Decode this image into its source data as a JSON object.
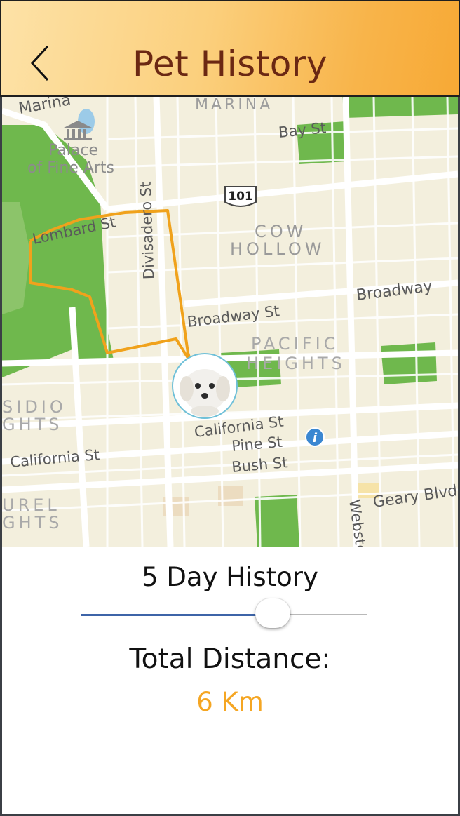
{
  "header": {
    "title": "Pet History",
    "back_icon": "chevron-left-icon"
  },
  "map": {
    "labels": {
      "marina_top": "Marina",
      "marina": "MARINA",
      "palace_1": "Palace",
      "palace_2": "of Fine Arts",
      "divisadero": "Divisadero St",
      "bay": "Bay St",
      "hwy": "101",
      "lombard": "Lombard St",
      "cow_1": "COW",
      "cow_2": "HOLLOW",
      "broadway_e": "Broadway",
      "broadway_st": "Broadway St",
      "pacific_1": "PACIFIC",
      "pacific_2": "HEIGHTS",
      "presidio_1": "SIDIO",
      "presidio_2": "GHTS",
      "laurel_1": "UREL",
      "laurel_2": "GHTS",
      "california_w": "California St",
      "california_e": "California St",
      "pine": "Pine St",
      "bush": "Bush St",
      "geary": "Geary Blvd",
      "webster": "Webster"
    },
    "route_color": "#f0a21c",
    "pet_marker_icon": "pet-avatar-icon",
    "info_icon": "info-icon"
  },
  "panel": {
    "history_label": "5 Day History",
    "slider_fraction": 0.67,
    "distance_label": "Total Distance:",
    "distance_value": "6 Km",
    "accent_color": "#f5a623"
  }
}
